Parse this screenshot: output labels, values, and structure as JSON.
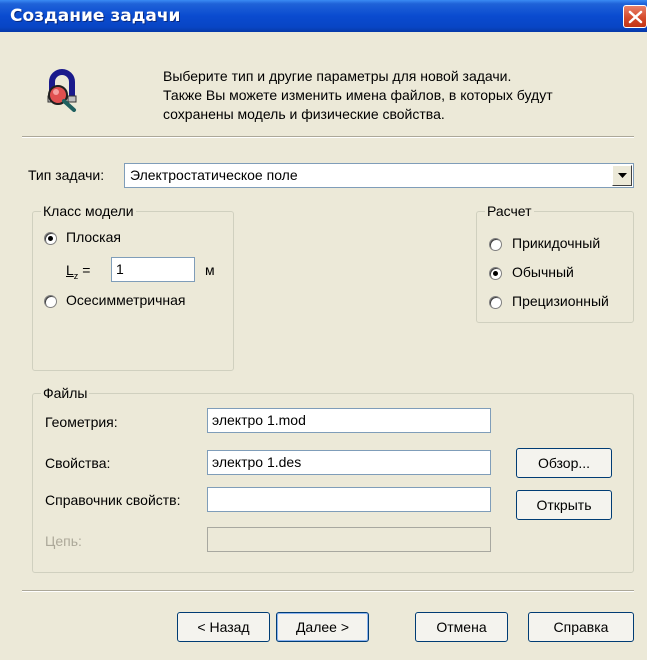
{
  "window": {
    "title": "Создание задачи"
  },
  "header": {
    "icon": "magnet-magnifier-icon",
    "line1": "Выберите тип и другие параметры для новой задачи.",
    "line2": "Также Вы можете изменить имена файлов, в которых будут",
    "line3": "сохранены модель и физические свойства."
  },
  "task_type": {
    "label": "Тип задачи:",
    "value": "Электростатическое поле"
  },
  "model_class": {
    "legend": "Класс модели",
    "planar_label": "Плоская",
    "lz_label": "L",
    "lz_subscript": "z",
    "lz_equals": "=",
    "lz_value": "1",
    "lz_unit": "м",
    "axisymmetric_label": "Осесимметричная",
    "selected": "planar"
  },
  "calculation": {
    "legend": "Расчет",
    "options": [
      "Прикидочный",
      "Обычный",
      "Прецизионный"
    ],
    "selected": "Обычный"
  },
  "files": {
    "legend": "Файлы",
    "geometry_label": "Геометрия:",
    "geometry_value": "электро 1.mod",
    "properties_label": "Свойства:",
    "properties_value": "электро 1.des",
    "reference_label": "Справочник свойств:",
    "reference_value": "",
    "circuit_label": "Цепь:",
    "circuit_value": "",
    "browse_label": "Обзор...",
    "open_label": "Открыть"
  },
  "buttons": {
    "back": "< Назад",
    "next": "Далее >",
    "cancel": "Отмена",
    "help": "Справка"
  },
  "colors": {
    "titlebar": "#0a4bd0",
    "dialog_bg": "#ece9d8",
    "close": "#d54b2c",
    "input_border": "#7f9db9"
  }
}
